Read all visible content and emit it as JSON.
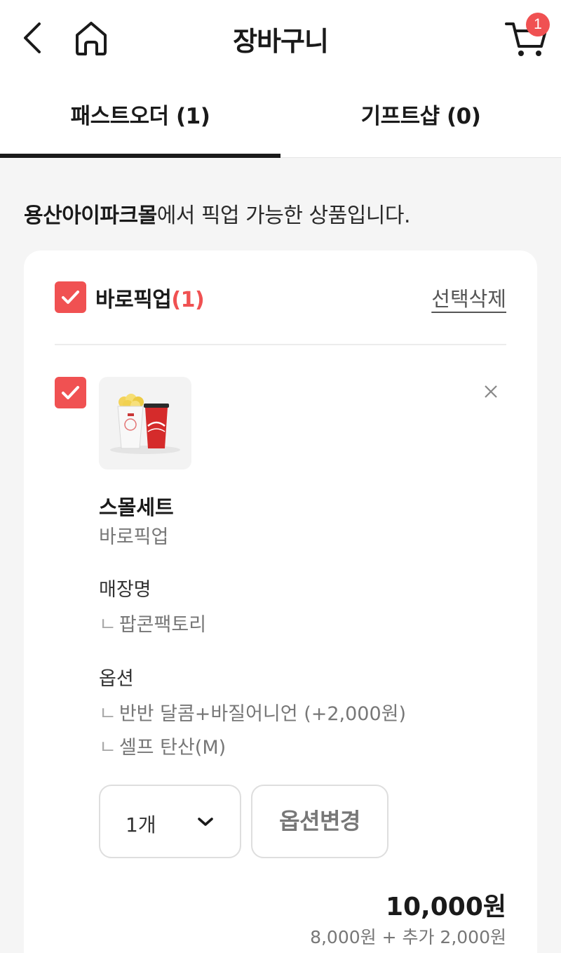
{
  "header": {
    "title": "장바구니",
    "cart_badge": "1"
  },
  "tabs": [
    {
      "label": "패스트오더 (1)",
      "active": true
    },
    {
      "label": "기프트샵 (0)",
      "active": false
    }
  ],
  "notice": {
    "store": "용산아이파크몰",
    "text": "에서 픽업 가능한 상품입니다."
  },
  "group": {
    "label": "바로픽업",
    "count": "(1)",
    "delete_selected": "선택삭제",
    "checked": true
  },
  "item": {
    "checked": true,
    "name": "스몰세트",
    "type": "바로픽업",
    "store_label": "매장명",
    "store_name": "팝콘팩토리",
    "option_label": "옵션",
    "options": [
      "반반 달콤+바질어니언 (+2,000원)",
      "셀프 탄산(M)"
    ],
    "quantity": "1개",
    "change_option": "옵션변경",
    "total_price": "10,000원",
    "price_breakdown": "8,000원 + 추가 2,000원"
  },
  "tick_glyph": "ㄴ",
  "colors": {
    "accent": "#f05152",
    "text": "#1a1a1a",
    "muted": "#777777",
    "background": "#f5f5f5"
  }
}
